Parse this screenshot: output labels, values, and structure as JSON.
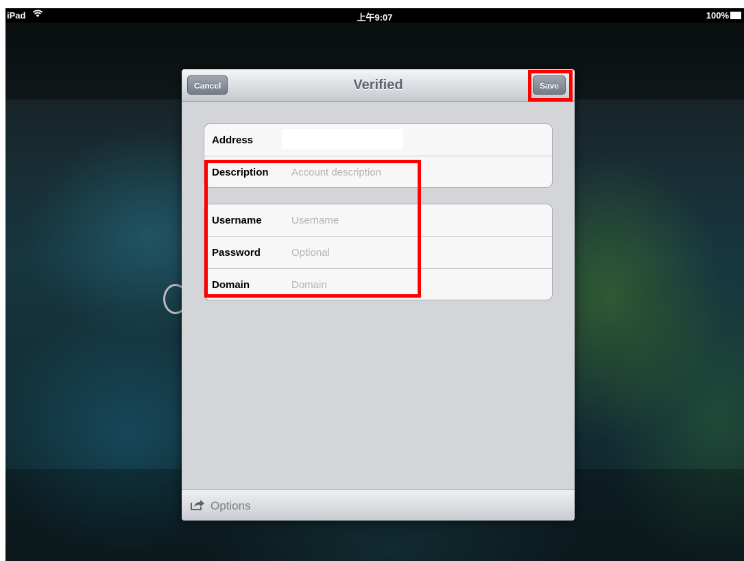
{
  "status_bar": {
    "carrier": "iPad",
    "time": "上午9:07",
    "battery": "100%",
    "wifi_icon": "wifi-icon",
    "battery_icon": "battery-icon"
  },
  "dialog": {
    "title": "Verified",
    "cancel_label": "Cancel",
    "save_label": "Save"
  },
  "account_group": {
    "rows": [
      {
        "label": "Address",
        "value": "",
        "placeholder": ""
      },
      {
        "label": "Description",
        "value": "",
        "placeholder": "Account description"
      }
    ]
  },
  "credentials_group": {
    "rows": [
      {
        "label": "Username",
        "value": "",
        "placeholder": "Username"
      },
      {
        "label": "Password",
        "value": "",
        "placeholder": "Optional"
      },
      {
        "label": "Domain",
        "value": "",
        "placeholder": "Domain"
      }
    ]
  },
  "toolbar": {
    "options_label": "Options",
    "options_icon": "share-icon"
  },
  "colors": {
    "highlight": "#ff0000",
    "title": "#5e6674",
    "placeholder": "#b3b3b3"
  }
}
